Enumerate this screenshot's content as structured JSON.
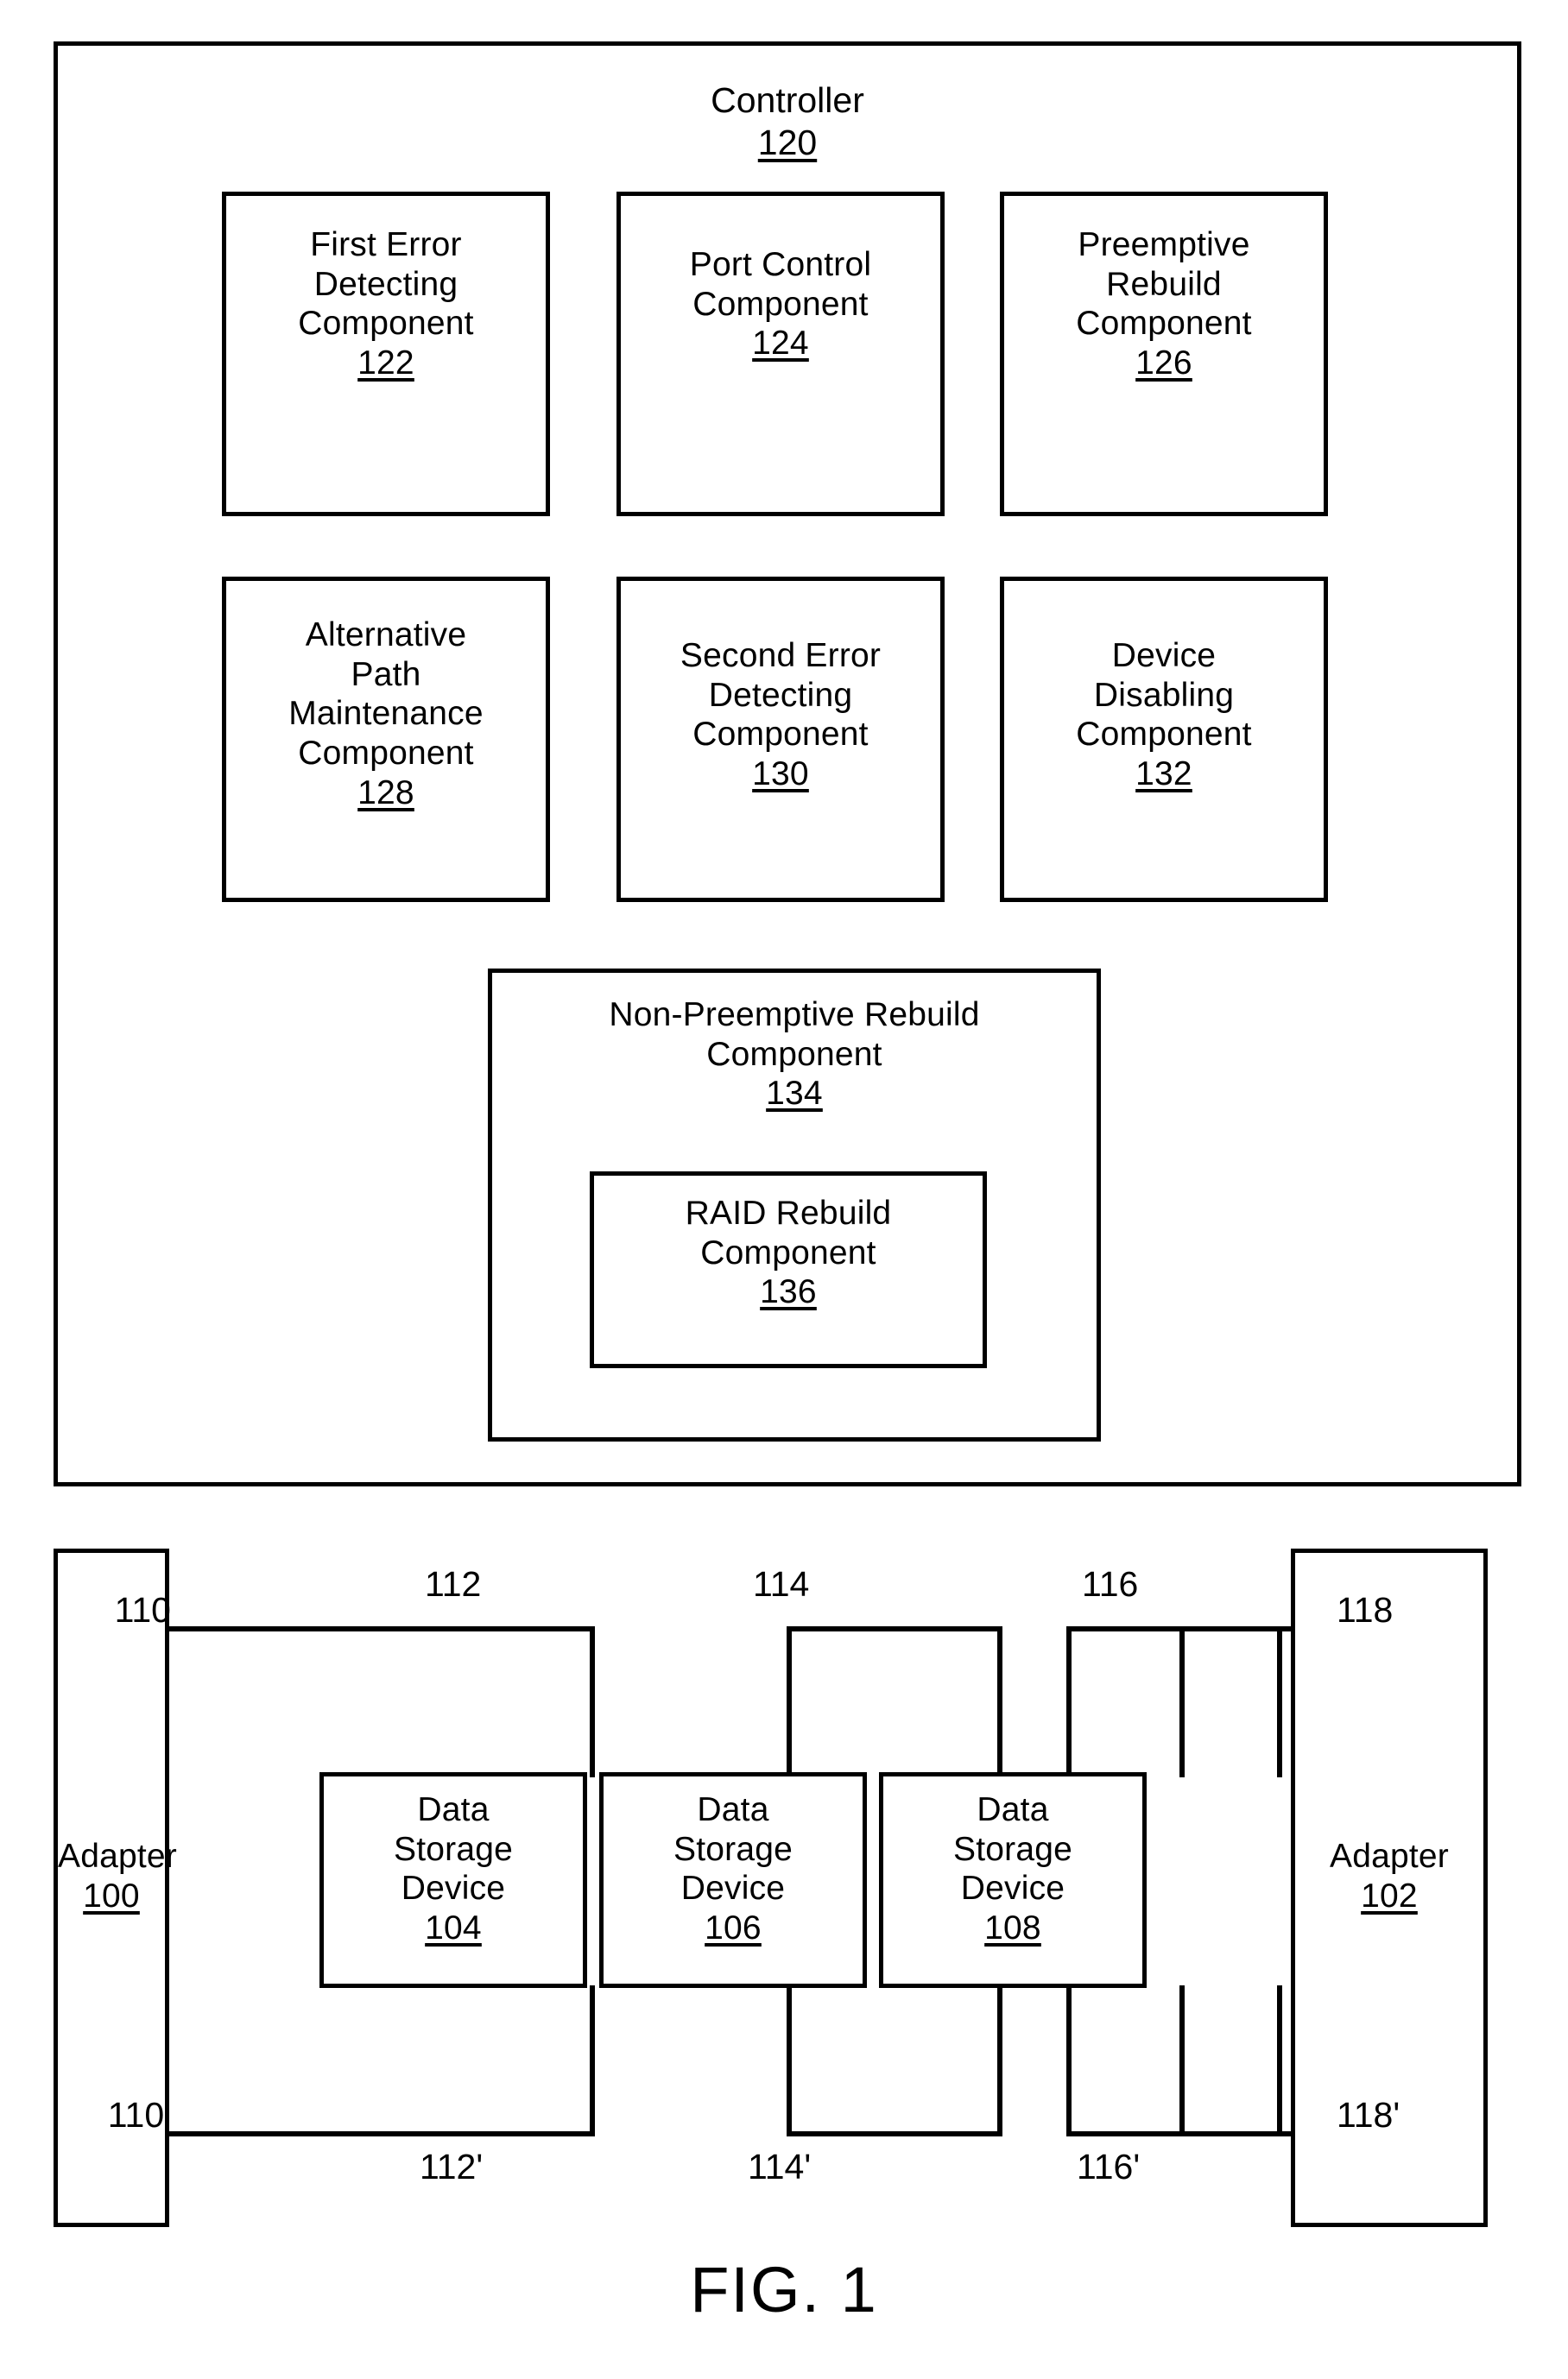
{
  "figure": {
    "caption": "FIG. 1",
    "controller": {
      "title": "Controller",
      "ref": "120",
      "components": [
        {
          "lines": [
            "First Error",
            "Detecting",
            "Component"
          ],
          "ref": "122"
        },
        {
          "lines": [
            "Port Control",
            "Component"
          ],
          "ref": "124"
        },
        {
          "lines": [
            "Preemptive",
            "Rebuild",
            "Component"
          ],
          "ref": "126"
        },
        {
          "lines": [
            "Alternative",
            "Path",
            "Maintenance",
            "Component"
          ],
          "ref": "128"
        },
        {
          "lines": [
            "Second Error",
            "Detecting",
            "Component"
          ],
          "ref": "130"
        },
        {
          "lines": [
            "Device",
            "Disabling",
            "Component"
          ],
          "ref": "132"
        }
      ],
      "non_preemptive": {
        "lines": [
          "Non-Preemptive Rebuild",
          "Component"
        ],
        "ref": "134",
        "inner": {
          "lines": [
            "RAID Rebuild",
            "Component"
          ],
          "ref": "136"
        }
      }
    },
    "fabric": {
      "adapters": [
        {
          "lines": [
            "Adapter"
          ],
          "ref": "100",
          "port_top": "110",
          "port_bottom": "110'"
        },
        {
          "lines": [
            "Adapter"
          ],
          "ref": "102",
          "port_top": "118",
          "port_bottom": "118'"
        }
      ],
      "devices": [
        {
          "lines": [
            "Data",
            "Storage",
            "Device"
          ],
          "ref": "104"
        },
        {
          "lines": [
            "Data",
            "Storage",
            "Device"
          ],
          "ref": "106"
        },
        {
          "lines": [
            "Data",
            "Storage",
            "Device"
          ],
          "ref": "108"
        }
      ],
      "links_top": [
        "112",
        "114",
        "116"
      ],
      "links_bottom": [
        "112'",
        "114'",
        "116'"
      ]
    }
  },
  "colors": {
    "stroke": "#000000",
    "background": "#ffffff"
  }
}
